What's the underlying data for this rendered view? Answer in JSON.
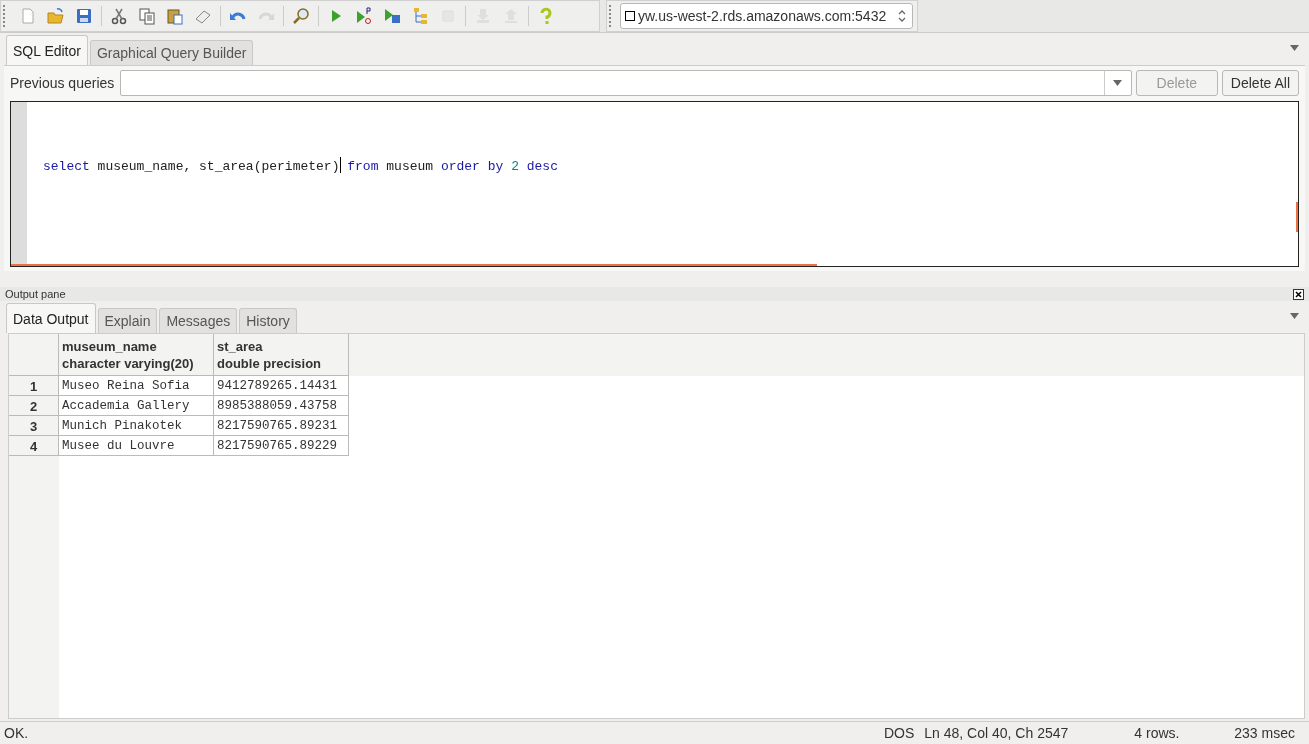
{
  "toolbar": [
    {
      "kind": "new",
      "disabled": false
    },
    {
      "kind": "open",
      "disabled": false
    },
    {
      "kind": "save",
      "disabled": false
    },
    {
      "kind": "sep"
    },
    {
      "kind": "cut",
      "disabled": false
    },
    {
      "kind": "copy",
      "disabled": false
    },
    {
      "kind": "paste",
      "disabled": false
    },
    {
      "kind": "eraser",
      "disabled": false
    },
    {
      "kind": "sep"
    },
    {
      "kind": "undo",
      "disabled": false
    },
    {
      "kind": "redo",
      "disabled": true
    },
    {
      "kind": "sep"
    },
    {
      "kind": "find",
      "disabled": false
    },
    {
      "kind": "sep"
    },
    {
      "kind": "run",
      "disabled": false
    },
    {
      "kind": "run-script",
      "disabled": false
    },
    {
      "kind": "run-file",
      "disabled": false
    },
    {
      "kind": "explain",
      "disabled": false
    },
    {
      "kind": "stop",
      "disabled": true
    },
    {
      "kind": "sep"
    },
    {
      "kind": "download",
      "disabled": true
    },
    {
      "kind": "upload",
      "disabled": true
    },
    {
      "kind": "sep"
    },
    {
      "kind": "help",
      "disabled": false
    }
  ],
  "connection": {
    "value": "yw.us-west-2.rds.amazonaws.com:5432"
  },
  "editor_tabs": [
    {
      "label": "SQL Editor",
      "selected": true
    },
    {
      "label": "Graphical Query Builder",
      "selected": false
    }
  ],
  "previous_queries": {
    "label": "Previous queries",
    "buttons": [
      {
        "label": "Delete",
        "disabled": true
      },
      {
        "label": "Delete All",
        "disabled": false
      }
    ]
  },
  "sql": [
    {
      "text": "select",
      "kind": "keyword",
      "cursor": false
    },
    {
      "text": " museum_name, st_area(perimeter) ",
      "kind": "plain",
      "cursor": true
    },
    {
      "text": "from",
      "kind": "keyword",
      "cursor": false
    },
    {
      "text": " museum ",
      "kind": "plain",
      "cursor": false
    },
    {
      "text": "order by ",
      "kind": "keyword",
      "cursor": false
    },
    {
      "text": "2 ",
      "kind": "number",
      "cursor": false
    },
    {
      "text": "desc",
      "kind": "keyword",
      "cursor": false
    }
  ],
  "output_pane": {
    "title": "Output pane",
    "tabs": [
      {
        "label": "Data Output",
        "selected": true
      },
      {
        "label": "Explain",
        "selected": false
      },
      {
        "label": "Messages",
        "selected": false
      },
      {
        "label": "History",
        "selected": false
      }
    ],
    "table": {
      "columns": [
        {
          "name": "museum_name",
          "type": "character varying(20)"
        },
        {
          "name": "st_area",
          "type": "double precision"
        }
      ],
      "rows": [
        {
          "number": "1",
          "cells": [
            "Museo Reina Sofia",
            "9412789265.14431"
          ]
        },
        {
          "number": "2",
          "cells": [
            "Accademia Gallery",
            "8985388059.43758"
          ]
        },
        {
          "number": "3",
          "cells": [
            "Munich Pinakotek",
            "8217590765.89231"
          ]
        },
        {
          "number": "4",
          "cells": [
            "Musee du Louvre",
            "8217590765.89229"
          ]
        }
      ]
    }
  },
  "status_bar": {
    "message": "OK.",
    "line_ending": "DOS",
    "position": "Ln 48, Col 40, Ch 2547",
    "rows": "4 rows.",
    "time": "233 msec"
  }
}
